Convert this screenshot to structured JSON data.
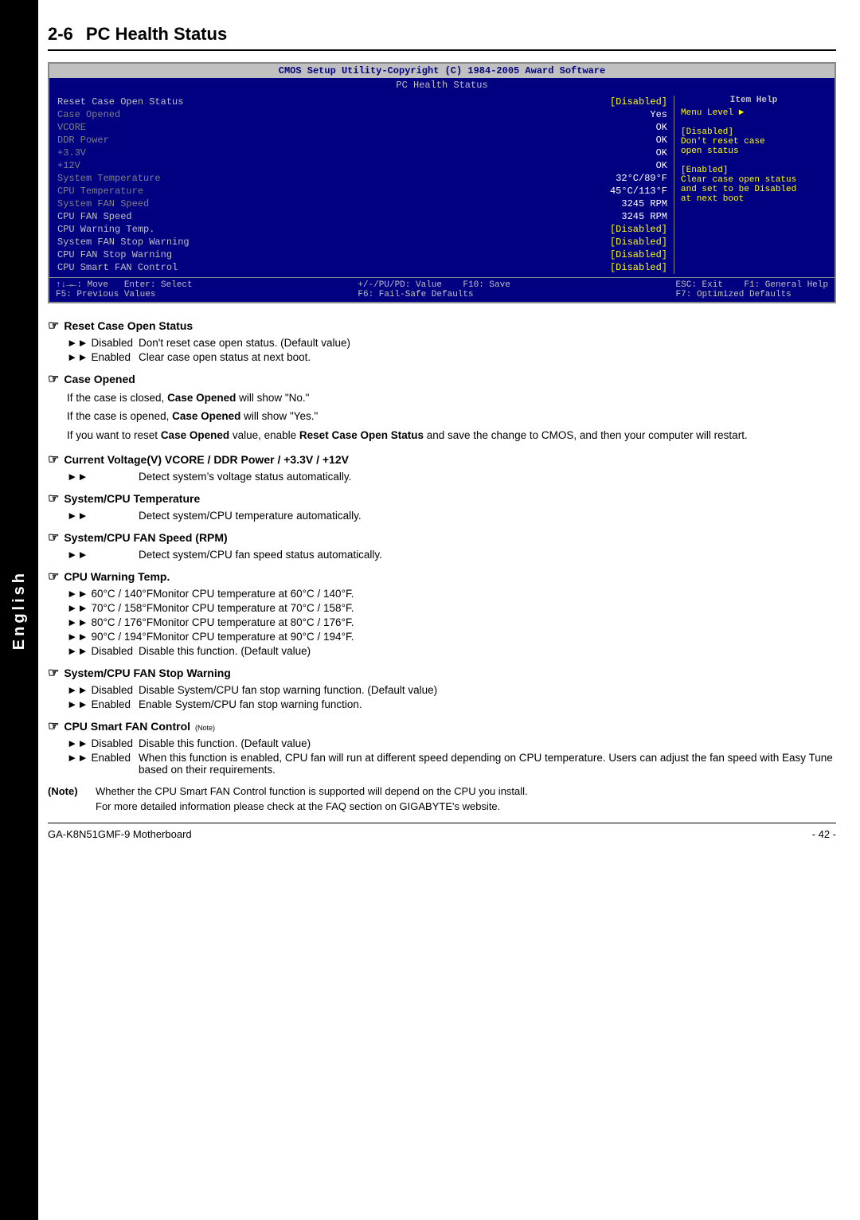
{
  "sidebar": {
    "label": "English"
  },
  "section": {
    "number": "2-6",
    "title": "PC Health Status"
  },
  "bios": {
    "title": "CMOS Setup Utility-Copyright (C) 1984-2005 Award Software",
    "subtitle": "PC Health Status",
    "rows": [
      {
        "label": "Reset Case Open Status",
        "value": "[Disabled]",
        "highlight": true
      },
      {
        "label": "Case Opened",
        "value": "Yes",
        "highlight": false
      },
      {
        "label": "VCORE",
        "value": "OK",
        "highlight": false
      },
      {
        "label": "DDR Power",
        "value": "OK",
        "highlight": false
      },
      {
        "label": "+3.3V",
        "value": "OK",
        "highlight": false
      },
      {
        "label": "+12V",
        "value": "OK",
        "highlight": false
      },
      {
        "label": "System Temperature",
        "value": "32°C/89°F",
        "highlight": false
      },
      {
        "label": "CPU Temperature",
        "value": "45°C/113°F",
        "highlight": false
      },
      {
        "label": "System FAN Speed",
        "value": "3245 RPM",
        "highlight": false
      },
      {
        "label": "CPU FAN Speed",
        "value": "3245 RPM",
        "highlight": false
      },
      {
        "label": "CPU Warning Temp.",
        "value": "[Disabled]",
        "highlight": true
      },
      {
        "label": "System FAN Stop Warning",
        "value": "[Disabled]",
        "highlight": true
      },
      {
        "label": "CPU FAN Stop Warning",
        "value": "[Disabled]",
        "highlight": true
      },
      {
        "label": "CPU Smart FAN Control",
        "value": "[Disabled]",
        "highlight": true
      }
    ],
    "help_title": "Item Help",
    "help_lines": [
      "Menu Level  ►",
      "",
      "[Disabled]",
      "Don't reset case",
      "open status",
      "",
      "[Enabled]",
      "Clear case open status",
      "and set to be Disabled",
      "at next boot"
    ],
    "footer": [
      "↑↓→←: Move    Enter: Select",
      "+/-/PU/PD: Value    F10: Save",
      "ESC: Exit    F1: General Help",
      "F5: Previous Values    F6: Fail-Safe Defaults    F7: Optimized Defaults"
    ]
  },
  "descriptions": [
    {
      "id": "reset-case",
      "heading": "Reset Case Open Status",
      "items": [
        {
          "bullet": "►► Disabled",
          "text": "Don't reset case open status. (Default value)"
        },
        {
          "bullet": "►► Enabled",
          "text": "Clear case open status at next boot."
        }
      ],
      "paras": []
    },
    {
      "id": "case-opened",
      "heading": "Case Opened",
      "items": [],
      "paras": [
        "If the case is closed, <b>Case Opened</b> will show \"No.\"",
        "If the case is opened, <b>Case Opened</b> will show \"Yes.\"",
        "If you want to reset <b>Case Opened</b> value, enable <b>Reset Case Open Status</b> and save the change to CMOS, and then your computer will restart."
      ]
    },
    {
      "id": "voltage",
      "heading": "Current Voltage(V) VCORE / DDR Power / +3.3V / +12V",
      "items": [
        {
          "bullet": "►►",
          "text": "Detect system’s voltage status automatically."
        }
      ],
      "paras": []
    },
    {
      "id": "sys-cpu-temp",
      "heading": "System/CPU Temperature",
      "items": [
        {
          "bullet": "►►",
          "text": "Detect system/CPU temperature automatically."
        }
      ],
      "paras": []
    },
    {
      "id": "sys-cpu-fan",
      "heading": "System/CPU FAN Speed (RPM)",
      "items": [
        {
          "bullet": "►►",
          "text": "Detect system/CPU fan speed status automatically."
        }
      ],
      "paras": []
    },
    {
      "id": "cpu-warning",
      "heading": "CPU Warning Temp.",
      "items": [
        {
          "bullet": "►► 60°C / 140°F",
          "text": "Monitor CPU temperature at 60°C / 140°F."
        },
        {
          "bullet": "►► 70°C / 158°F",
          "text": "Monitor CPU temperature at 70°C / 158°F."
        },
        {
          "bullet": "►► 80°C / 176°F",
          "text": "Monitor CPU temperature at 80°C / 176°F."
        },
        {
          "bullet": "►► 90°C / 194°F",
          "text": "Monitor CPU temperature at 90°C / 194°F."
        },
        {
          "bullet": "►► Disabled",
          "text": "Disable this function. (Default value)"
        }
      ],
      "paras": []
    },
    {
      "id": "sys-fan-stop",
      "heading": "System/CPU FAN Stop Warning",
      "items": [
        {
          "bullet": "►► Disabled",
          "text": "Disable System/CPU fan stop warning function. (Default value)"
        },
        {
          "bullet": "►► Enabled",
          "text": "Enable System/CPU fan stop warning function."
        }
      ],
      "paras": []
    },
    {
      "id": "cpu-smart-fan",
      "heading": "CPU Smart FAN Control",
      "heading_note": "Note",
      "items": [
        {
          "bullet": "►► Disabled",
          "text": "Disable this function. (Default value)"
        },
        {
          "bullet": "►► Enabled",
          "text": "When this function is enabled, CPU fan will run at different speed depending on CPU temperature. Users can adjust the fan speed with Easy Tune based on their requirements."
        }
      ],
      "paras": []
    }
  ],
  "note": {
    "label": "(Note)",
    "lines": [
      "Whether the CPU Smart FAN Control function is supported will depend on the CPU you install.",
      "For more detailed information please check at the FAQ section on GIGABYTE's website."
    ]
  },
  "footer": {
    "left": "GA-K8N51GMF-9 Motherboard",
    "right": "- 42 -"
  }
}
